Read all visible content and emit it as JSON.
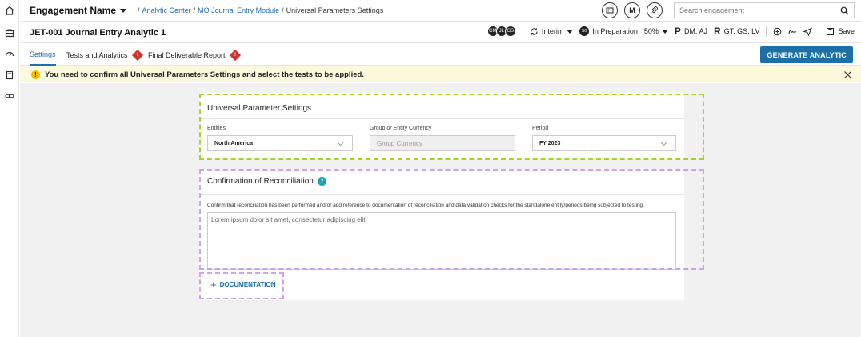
{
  "header": {
    "engagement_name": "Engagement Name",
    "breadcrumb": {
      "separator": "/",
      "link1": "Analytic Center",
      "link2": "MO Journal Entry Module",
      "current": "Universal Parameters Settings"
    },
    "circle_button_m": "M",
    "search_placeholder": "Search engagement"
  },
  "analytic_bar": {
    "title": "JET-001 Journal Entry Analytic 1",
    "avatars": [
      "GM",
      "JL",
      "GS"
    ],
    "phase": "Interim",
    "status_initials": "SG",
    "status": "In Preparation",
    "progress": "50%",
    "preparer_letter": "P",
    "preparers": "DM, AJ",
    "reviewer_letter": "R",
    "reviewers": "GT, GS, LV",
    "save_label": "Save"
  },
  "tabs": {
    "settings": "Settings",
    "tests": "Tests and Analytics",
    "final": "Final Deliverable Report",
    "error_mark": "!",
    "generate": "GENERATE ANALYTIC"
  },
  "warning": {
    "icon": "!",
    "message": "You need to confirm all Universal Parameters Settings and select the tests to be applied."
  },
  "universal": {
    "title": "Universal Parameter Settings",
    "entities_label": "Entities",
    "entities_value": "North America",
    "currency_label": "Group or Entity Currency",
    "currency_placeholder": "Group Currency",
    "period_label": "Period",
    "period_value": "FY 2023"
  },
  "confirmation": {
    "title": "Confirmation of Reconciliation",
    "info_mark": "?",
    "description": "Confirm that reconciliation has been performed and/or add reference to documentation of reconciliation and data validation checks for the standalone entity/periods being subjected to testing.",
    "textarea_value": "Lorem ipsum dolor sit amet, consectetur adipiscing elit.",
    "doc_plus": "+",
    "doc_button": "DOCUMENTATION"
  },
  "icons": {
    "rail": [
      "home-icon",
      "briefcase-icon",
      "speedometer-icon",
      "book-icon",
      "link-icon"
    ],
    "search": "search-icon",
    "close": "close-icon"
  },
  "colors": {
    "accent": "#1c6fa7",
    "error": "#d0332b",
    "warning_bg": "#fdf9dd",
    "warning_icon": "#f2bf00",
    "highlight_green": "#a6d12b",
    "highlight_purple": "#cf9ff0",
    "info": "#1ba1b0"
  }
}
